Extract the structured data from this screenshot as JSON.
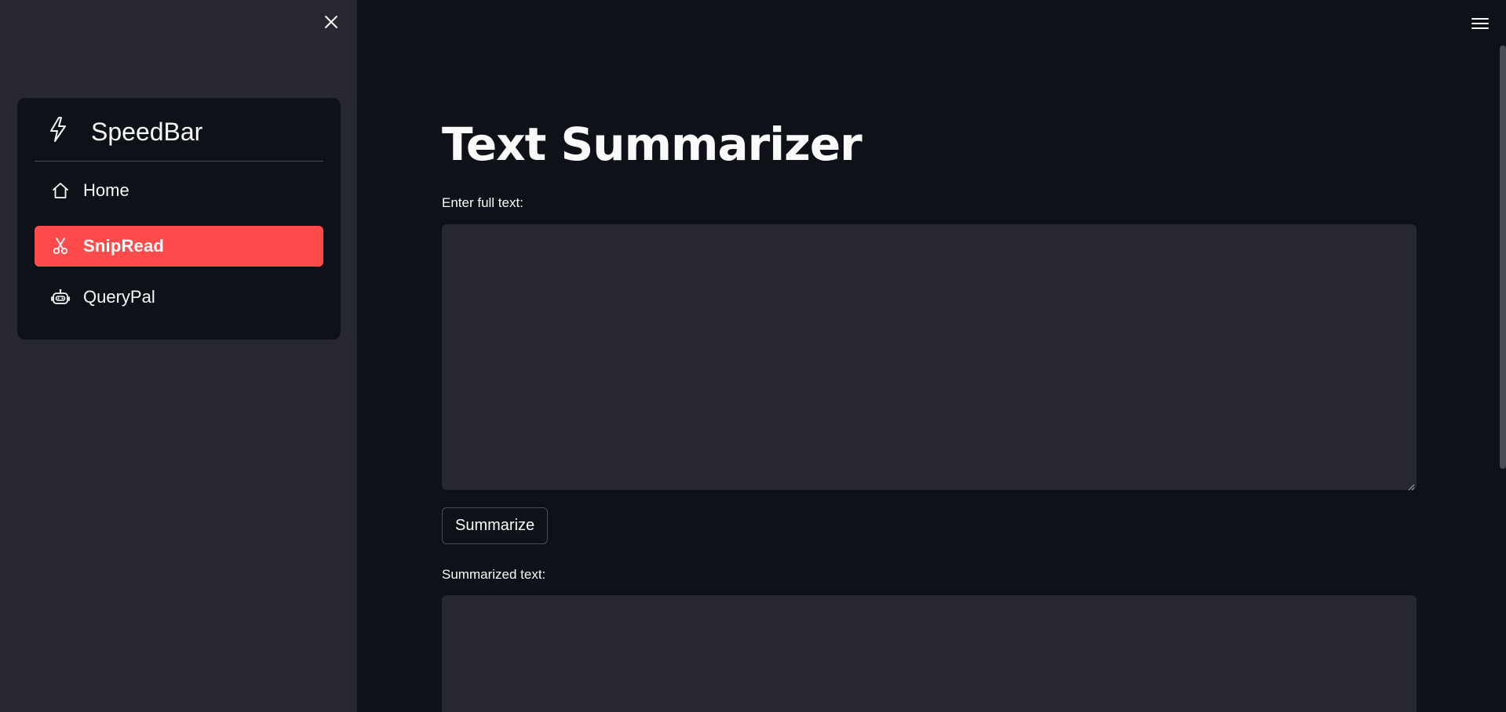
{
  "sidebar": {
    "brand": {
      "title": "SpeedBar",
      "icon": "lightning-icon"
    },
    "items": [
      {
        "label": "Home",
        "icon": "home-icon",
        "active": false
      },
      {
        "label": "SnipRead",
        "icon": "scissors-icon",
        "active": true
      },
      {
        "label": "QueryPal",
        "icon": "robot-icon",
        "active": false
      }
    ],
    "accent_color": "#ff4b4b"
  },
  "main": {
    "title": "Text Summarizer",
    "input_label": "Enter full text:",
    "input_value": "",
    "button_label": "Summarize",
    "output_label": "Summarized text:",
    "output_value": ""
  },
  "colors": {
    "background": "#0e1117",
    "sidebar": "#262730",
    "field": "#262730",
    "text": "#fafafa"
  }
}
